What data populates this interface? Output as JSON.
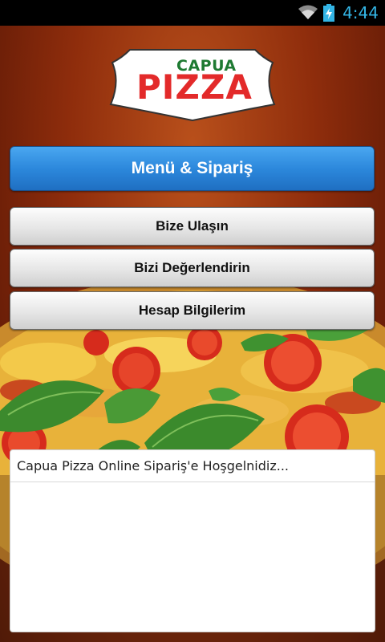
{
  "status_bar": {
    "time": "4:44",
    "wifi_icon": "wifi-icon",
    "battery_icon": "battery-charging-icon",
    "accent_color": "#33b5e5"
  },
  "logo": {
    "small_text": "CAPUA",
    "big_text": "PIZZA"
  },
  "buttons": {
    "menu_order": "Menü & Sipariş",
    "contact_us": "Bize Ulaşın",
    "rate_us": "Bizi Değerlendirin",
    "my_account": "Hesap Bilgilerim"
  },
  "message_panel": {
    "welcome": "Capua Pizza Online Sipariş'e Hoşgelnidiz..."
  },
  "colors": {
    "primary_button": "#2c88dc",
    "logo_red": "#e32a2a",
    "logo_green": "#1e7a32"
  }
}
